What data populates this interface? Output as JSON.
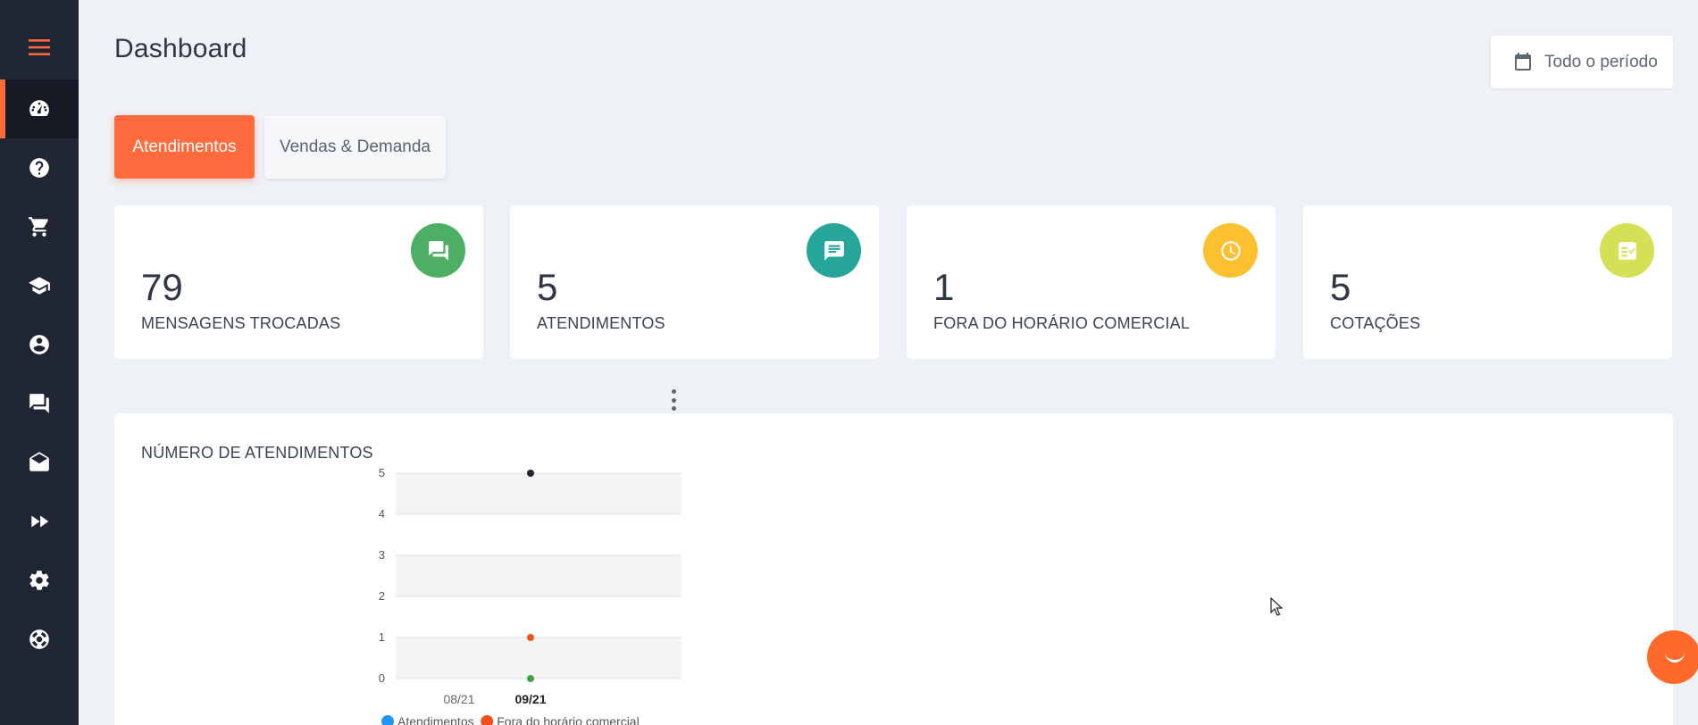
{
  "header": {
    "title": "Dashboard",
    "period_label": "Todo o período"
  },
  "sidebar": {
    "items": [
      {
        "icon": "dashboard-icon",
        "active": true
      },
      {
        "icon": "help-icon",
        "active": false
      },
      {
        "icon": "cart-icon",
        "active": false
      },
      {
        "icon": "school-icon",
        "active": false
      },
      {
        "icon": "account-icon",
        "active": false
      },
      {
        "icon": "forum-icon",
        "active": false
      },
      {
        "icon": "mail-open-icon",
        "active": false
      },
      {
        "icon": "fast-forward-icon",
        "active": false
      },
      {
        "icon": "settings-icon",
        "active": false
      },
      {
        "icon": "support-icon",
        "active": false
      }
    ]
  },
  "tabs": [
    {
      "label": "Atendimentos",
      "active": true
    },
    {
      "label": "Vendas & Demanda",
      "active": false
    }
  ],
  "stats": [
    {
      "value": "79",
      "label": "MENSAGENS TROCADAS",
      "color": "#4caf63",
      "icon": "forum-icon"
    },
    {
      "value": "5",
      "label": "ATENDIMENTOS",
      "color": "#26a69a",
      "icon": "chat-icon"
    },
    {
      "value": "1",
      "label": "FORA DO HORÁRIO COMERCIAL",
      "color": "#fdc02f",
      "icon": "clock-icon"
    },
    {
      "value": "5",
      "label": "COTAÇÕES",
      "color": "#d4e157",
      "icon": "checklist-icon"
    }
  ],
  "colors": {
    "accent": "#ff6b3d",
    "sidebar": "#1f2532"
  },
  "chart_data": {
    "type": "scatter",
    "title": "NÚMERO DE ATENDIMENTOS",
    "categories": [
      "08/21",
      "09/21"
    ],
    "ylim": [
      0,
      5
    ],
    "yticks": [
      0,
      1,
      2,
      3,
      4,
      5
    ],
    "series": [
      {
        "name": "Atendimentos",
        "color": "#1e2433",
        "values": [
          null,
          5
        ]
      },
      {
        "name": "Fora do horário comercial",
        "color": "#f4511e",
        "values": [
          null,
          1
        ]
      },
      {
        "color": "#43a047",
        "values": [
          null,
          0
        ]
      }
    ],
    "legend_position": "bottom",
    "legend": [
      {
        "name": "Atendimentos",
        "color": "#2196f3"
      },
      {
        "name": "Fora do horário comercial",
        "color": "#f4511e"
      }
    ]
  }
}
